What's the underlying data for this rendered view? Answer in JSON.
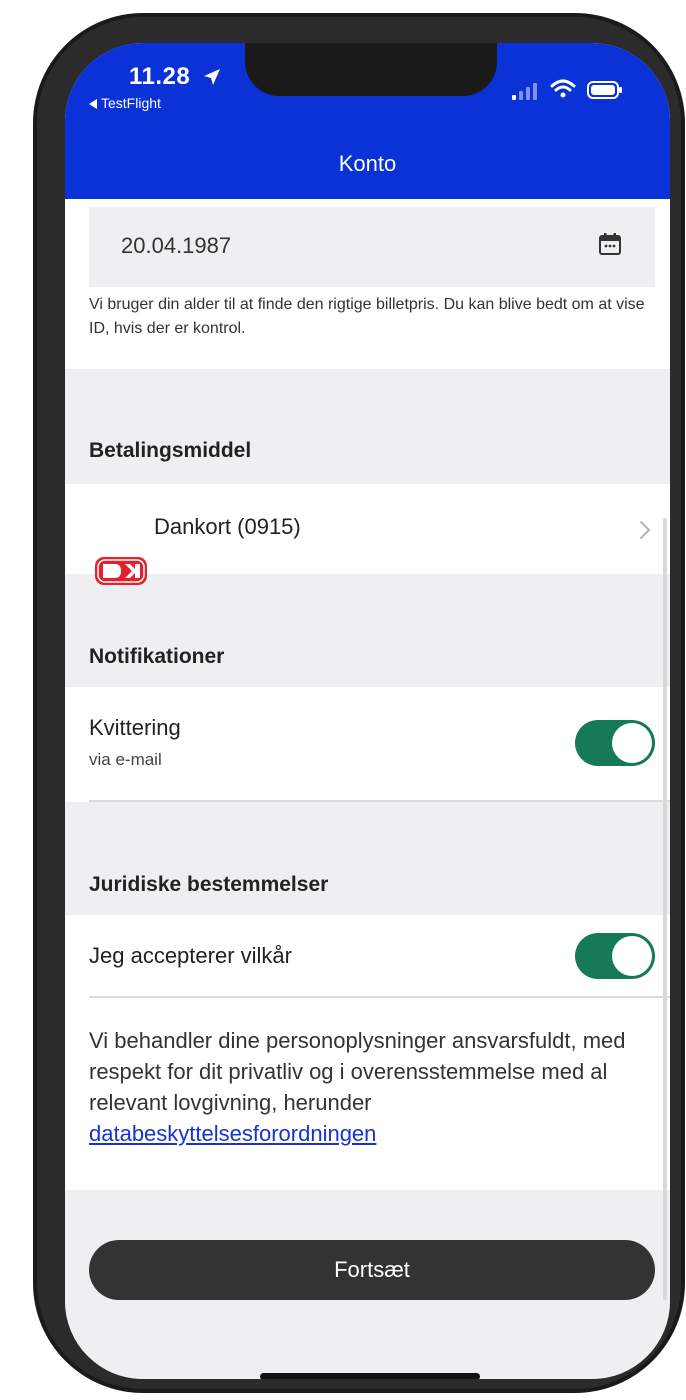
{
  "status_bar": {
    "time": "11.28",
    "back_app": "TestFlight"
  },
  "nav": {
    "title": "Konto"
  },
  "birthdate": {
    "value": "20.04.1987",
    "help_text": "Vi bruger din alder til at finde den rigtige billetpris. Du kan blive bedt om at vise ID, hvis der er kontrol."
  },
  "payment": {
    "section_title": "Betalingsmiddel",
    "card_label": "Dankort (0915)",
    "card_icon": "dankort-logo"
  },
  "notifications": {
    "section_title": "Notifikationer",
    "receipt_label": "Kvittering",
    "receipt_sub": "via e-mail",
    "receipt_enabled": true
  },
  "legal": {
    "section_title": "Juridiske bestemmelser",
    "terms_label": "Jeg accepterer vilkår",
    "terms_enabled": true,
    "privacy_text": "Vi behandler dine personoplysninger ansvarsfuldt, med respekt for dit privatliv og i overensstemmelse med al relevant lovgivning, herunder ",
    "privacy_link": "databeskyttelsesforordningen"
  },
  "cta": {
    "label": "Fortsæt"
  },
  "colors": {
    "brand_blue": "#0a32d6",
    "toggle_green": "#157a55",
    "link_blue": "#1733d1",
    "button_dark": "#333333"
  }
}
